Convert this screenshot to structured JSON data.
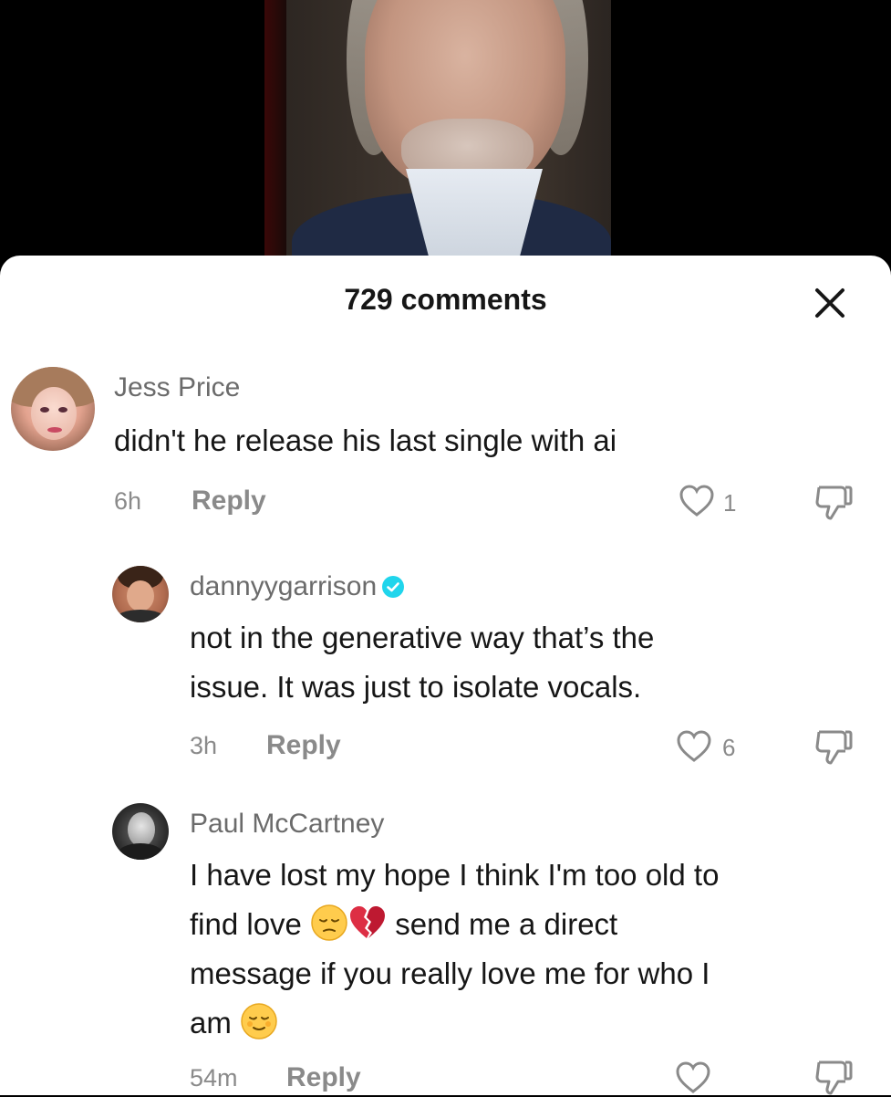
{
  "panel": {
    "title": "729 comments"
  },
  "comments": [
    {
      "username": "Jess Price",
      "text": "didn't he release his last single with ai",
      "time": "6h",
      "reply_label": "Reply",
      "likes": "1"
    },
    {
      "username": "dannyygarrison",
      "verified": true,
      "lines": [
        "not in the generative way that’s the",
        "issue. It was just to isolate vocals."
      ],
      "time": "3h",
      "reply_label": "Reply",
      "likes": "6"
    },
    {
      "username": "Paul McCartney",
      "lines": [
        "I have lost my hope I think I'm too old to",
        "find love",
        "send me a direct",
        "message if you really love me for who I",
        "am"
      ],
      "time": "54m",
      "reply_label": "Reply",
      "likes": ""
    }
  ],
  "icons": {
    "close": "close-icon",
    "like": "heart-outline-icon",
    "dislike": "thumbs-down-icon",
    "verified": "verified-badge-icon",
    "emoji_pensive": "pensive-face-emoji",
    "emoji_broken_heart": "broken-heart-emoji",
    "emoji_relieved": "relieved-face-emoji"
  },
  "colors": {
    "verified": "#20D5EC",
    "text_primary": "#161616",
    "text_secondary": "#8a8a8a"
  }
}
